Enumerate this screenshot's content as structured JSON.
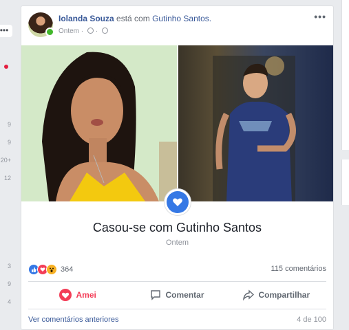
{
  "left_rail": {
    "more_label": "•••",
    "counts": [
      "9",
      "9",
      "20+",
      "12",
      "3",
      "9",
      "4"
    ]
  },
  "post": {
    "author": "Iolanda Souza",
    "connector": "está com",
    "with_person": "Gutinho Santos.",
    "time": "Ontem",
    "more_label": "•••",
    "event": {
      "title": "Casou-se com Gutinho Santos",
      "subtitle": "Ontem"
    },
    "stats": {
      "reactions_count": "364",
      "comments_count": "115 comentários",
      "reactions": [
        "like",
        "love",
        "wow"
      ]
    },
    "actions": [
      {
        "label": "Amei",
        "icon": "heart-icon",
        "active": true,
        "color": "#f33e58"
      },
      {
        "label": "Comentar",
        "icon": "comment-icon",
        "active": false
      },
      {
        "label": "Compartilhar",
        "icon": "share-icon",
        "active": false
      }
    ],
    "footer": {
      "prev_comments": "Ver comentários anteriores",
      "pager": "4 de 100"
    }
  },
  "colors": {
    "brand_blue": "#3578e5",
    "link_blue": "#385898",
    "love_red": "#f33e58",
    "online_green": "#42b72a"
  }
}
